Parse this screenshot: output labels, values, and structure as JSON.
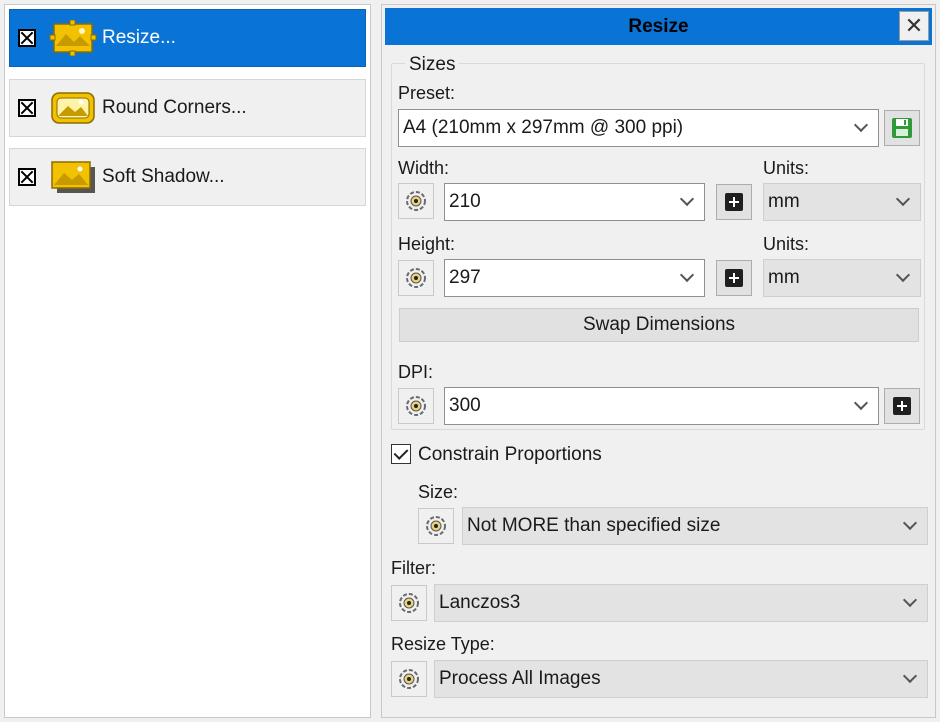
{
  "actions": [
    {
      "label": "Resize...",
      "checked": true,
      "selected": true,
      "icon": "resize-action-icon"
    },
    {
      "label": "Round Corners...",
      "checked": true,
      "selected": false,
      "icon": "round-corners-action-icon"
    },
    {
      "label": "Soft Shadow...",
      "checked": true,
      "selected": false,
      "icon": "soft-shadow-action-icon"
    }
  ],
  "panel": {
    "title": "Resize",
    "close_glyph": "✕",
    "sizes_group": "Sizes",
    "preset": {
      "label": "Preset:",
      "value": "A4 (210mm x 297mm @ 300 ppi)"
    },
    "width": {
      "label": "Width:",
      "value": "210",
      "units_label": "Units:",
      "units_value": "mm"
    },
    "height": {
      "label": "Height:",
      "value": "297",
      "units_label": "Units:",
      "units_value": "mm"
    },
    "swap_label": "Swap Dimensions",
    "dpi": {
      "label": "DPI:",
      "value": "300"
    },
    "constrain": {
      "label": "Constrain Proportions",
      "checked": true
    },
    "size": {
      "label": "Size:",
      "value": "Not MORE than specified size"
    },
    "filter": {
      "label": "Filter:",
      "value": "Lanczos3"
    },
    "resize_type": {
      "label": "Resize Type:",
      "value": "Process All Images"
    }
  },
  "colors": {
    "accent": "#0a73d6",
    "save_icon": "#2e9a3a",
    "icon_yellow": "#f2c200"
  }
}
